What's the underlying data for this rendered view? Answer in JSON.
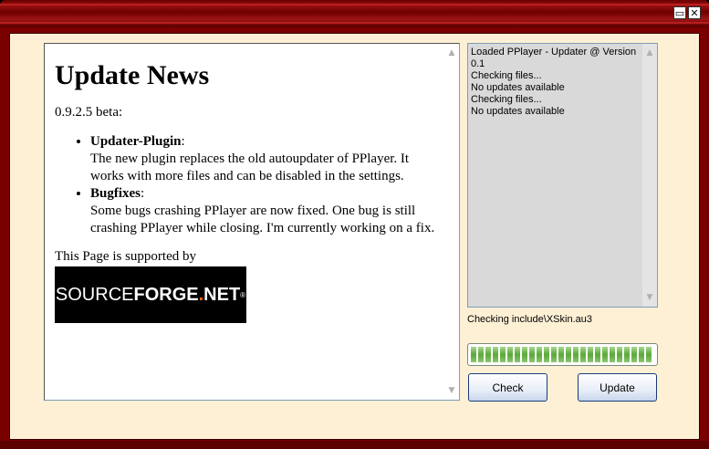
{
  "window": {
    "minimize_glyph": "▭",
    "close_glyph": "✕"
  },
  "news": {
    "heading": "Update News",
    "version": "0.9.2.5 beta:",
    "items": [
      {
        "title": "Updater-Plugin",
        "colon": ":",
        "text": "The new plugin replaces the old autoupdater of PPlayer. It works with more files and can be disabled in the settings."
      },
      {
        "title": "Bugfixes",
        "colon": ":",
        "text": "Some bugs crashing PPlayer are now fixed. One bug is still crashing PPlayer while closing. I'm currently working on a fix."
      }
    ],
    "supported_by": "This Page is supported by",
    "logo": {
      "part1": "SOURCE",
      "part2": "FORGE",
      "dot": ".",
      "part3": "NET",
      "reg": "®"
    }
  },
  "log": {
    "lines": [
      "Loaded PPlayer - Updater @ Version 0.1",
      "Checking files...",
      "No updates available",
      "Checking files...",
      "No updates available"
    ]
  },
  "status": "Checking include\\XSkin.au3",
  "progress": {
    "percent": 100
  },
  "buttons": {
    "check": "Check",
    "update": "Update"
  },
  "colors": {
    "frame": "#7a0000",
    "client_bg": "#fdf0d5",
    "progress_green": "#5aa83a"
  }
}
